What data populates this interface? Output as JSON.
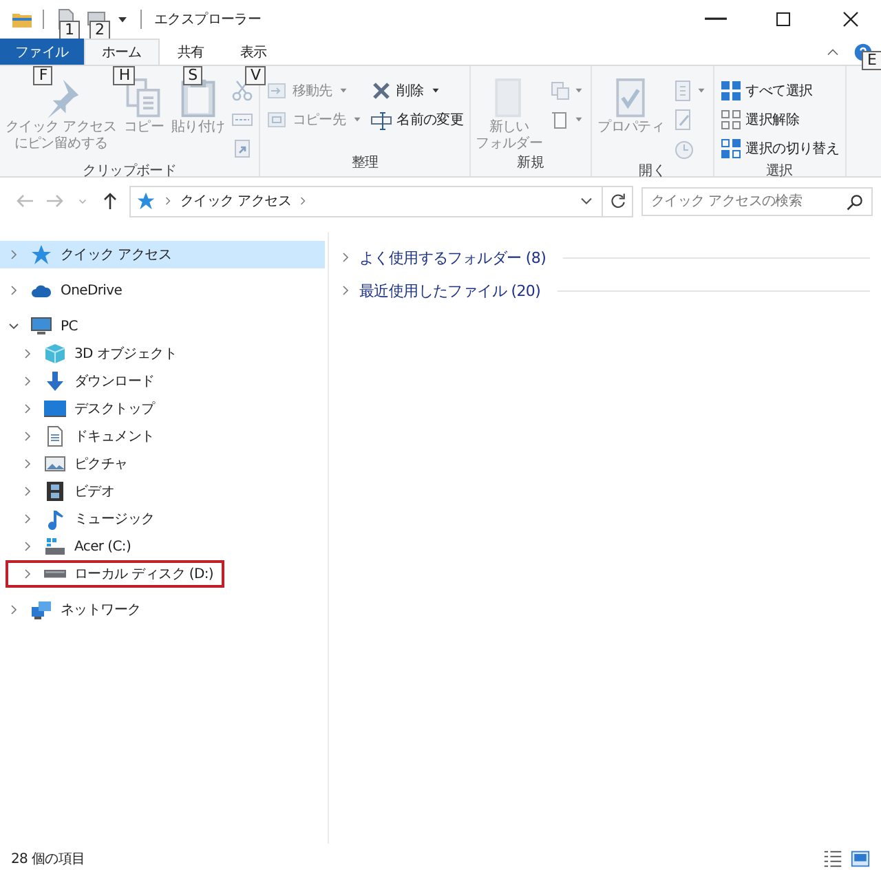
{
  "window": {
    "title": "エクスプローラー",
    "quick_access_keytips": [
      "1",
      "2"
    ],
    "help_keytip": "E"
  },
  "ribbon_tabs": [
    {
      "label": "ファイル",
      "kind": "file",
      "keytip": "F",
      "selected": false
    },
    {
      "label": "ホーム",
      "kind": "tab",
      "keytip": "H",
      "selected": true
    },
    {
      "label": "共有",
      "kind": "tab",
      "keytip": "S",
      "selected": false
    },
    {
      "label": "表示",
      "kind": "tab",
      "keytip": "V",
      "selected": false
    }
  ],
  "ribbon_groups": [
    {
      "label": "クリップボード",
      "columns": [
        [
          {
            "kind": "large",
            "lines": [
              "クイック アクセス",
              "にピン留めする"
            ],
            "disabled": true,
            "dropdown": false
          }
        ],
        [
          {
            "kind": "large",
            "lines": [
              "コピー"
            ],
            "disabled": true,
            "dropdown": false
          }
        ],
        [
          {
            "kind": "large",
            "lines": [
              "貼り付け"
            ],
            "disabled": true,
            "dropdown": false
          }
        ],
        [
          {
            "kind": "icon",
            "disabled": true,
            "dropdown": false
          },
          {
            "kind": "icon",
            "disabled": true,
            "dropdown": false
          },
          {
            "kind": "icon",
            "disabled": true,
            "dropdown": false
          }
        ]
      ]
    },
    {
      "label": "整理",
      "columns": [
        [
          {
            "kind": "small",
            "label": "移動先",
            "disabled": true,
            "dropdown": true
          },
          {
            "kind": "small",
            "label": "コピー先",
            "disabled": true,
            "dropdown": true
          }
        ],
        [
          {
            "kind": "small",
            "label": "削除",
            "disabled": false,
            "dropdown": true
          },
          {
            "kind": "small",
            "label": "名前の変更",
            "disabled": false,
            "dropdown": false
          }
        ]
      ]
    },
    {
      "label": "新規",
      "columns": [
        [
          {
            "kind": "large",
            "lines": [
              "新しい",
              "フォルダー"
            ],
            "disabled": true,
            "dropdown": false
          }
        ],
        [
          {
            "kind": "icon",
            "disabled": true,
            "dropdown": true
          },
          {
            "kind": "icon",
            "disabled": true,
            "dropdown": true
          }
        ]
      ]
    },
    {
      "label": "開く",
      "columns": [
        [
          {
            "kind": "large",
            "lines": [
              "プロパティ"
            ],
            "disabled": true,
            "dropdown": false
          }
        ],
        [
          {
            "kind": "icon",
            "disabled": true,
            "dropdown": true
          },
          {
            "kind": "icon",
            "disabled": true,
            "dropdown": false
          },
          {
            "kind": "icon",
            "disabled": true,
            "dropdown": false
          }
        ]
      ]
    },
    {
      "label": "選択",
      "columns": [
        [
          {
            "kind": "small",
            "label": "すべて選択",
            "disabled": false,
            "dropdown": false
          },
          {
            "kind": "small",
            "label": "選択解除",
            "disabled": false,
            "dropdown": false
          },
          {
            "kind": "small",
            "label": "選択の切り替え",
            "disabled": false,
            "dropdown": false
          }
        ]
      ]
    }
  ],
  "address_bar": {
    "path": [
      "クイック アクセス"
    ]
  },
  "search": {
    "placeholder": "クイック アクセスの検索"
  },
  "nav": [
    {
      "label": "クイック アクセス",
      "selected": true,
      "expanded": false,
      "highlighted": false
    },
    {
      "label": "OneDrive",
      "selected": false,
      "expanded": false,
      "highlighted": false
    },
    {
      "label": "PC",
      "selected": false,
      "expanded": true,
      "highlighted": false,
      "children": [
        {
          "label": "3D オブジェクト",
          "selected": false,
          "expanded": false,
          "highlighted": false
        },
        {
          "label": "ダウンロード",
          "selected": false,
          "expanded": false,
          "highlighted": false
        },
        {
          "label": "デスクトップ",
          "selected": false,
          "expanded": false,
          "highlighted": false
        },
        {
          "label": "ドキュメント",
          "selected": false,
          "expanded": false,
          "highlighted": false
        },
        {
          "label": "ピクチャ",
          "selected": false,
          "expanded": false,
          "highlighted": false
        },
        {
          "label": "ビデオ",
          "selected": false,
          "expanded": false,
          "highlighted": false
        },
        {
          "label": "ミュージック",
          "selected": false,
          "expanded": false,
          "highlighted": false
        },
        {
          "label": "Acer (C:)",
          "selected": false,
          "expanded": false,
          "highlighted": false
        },
        {
          "label": "ローカル ディスク (D:)",
          "selected": false,
          "expanded": false,
          "highlighted": true
        }
      ]
    },
    {
      "label": "ネットワーク",
      "selected": false,
      "expanded": false,
      "highlighted": false
    }
  ],
  "content_groups": [
    {
      "label": "よく使用するフォルダー (8)",
      "expanded": false
    },
    {
      "label": "最近使用したファイル (20)",
      "expanded": false
    }
  ],
  "status_bar": {
    "item_count": "28 個の項目"
  }
}
